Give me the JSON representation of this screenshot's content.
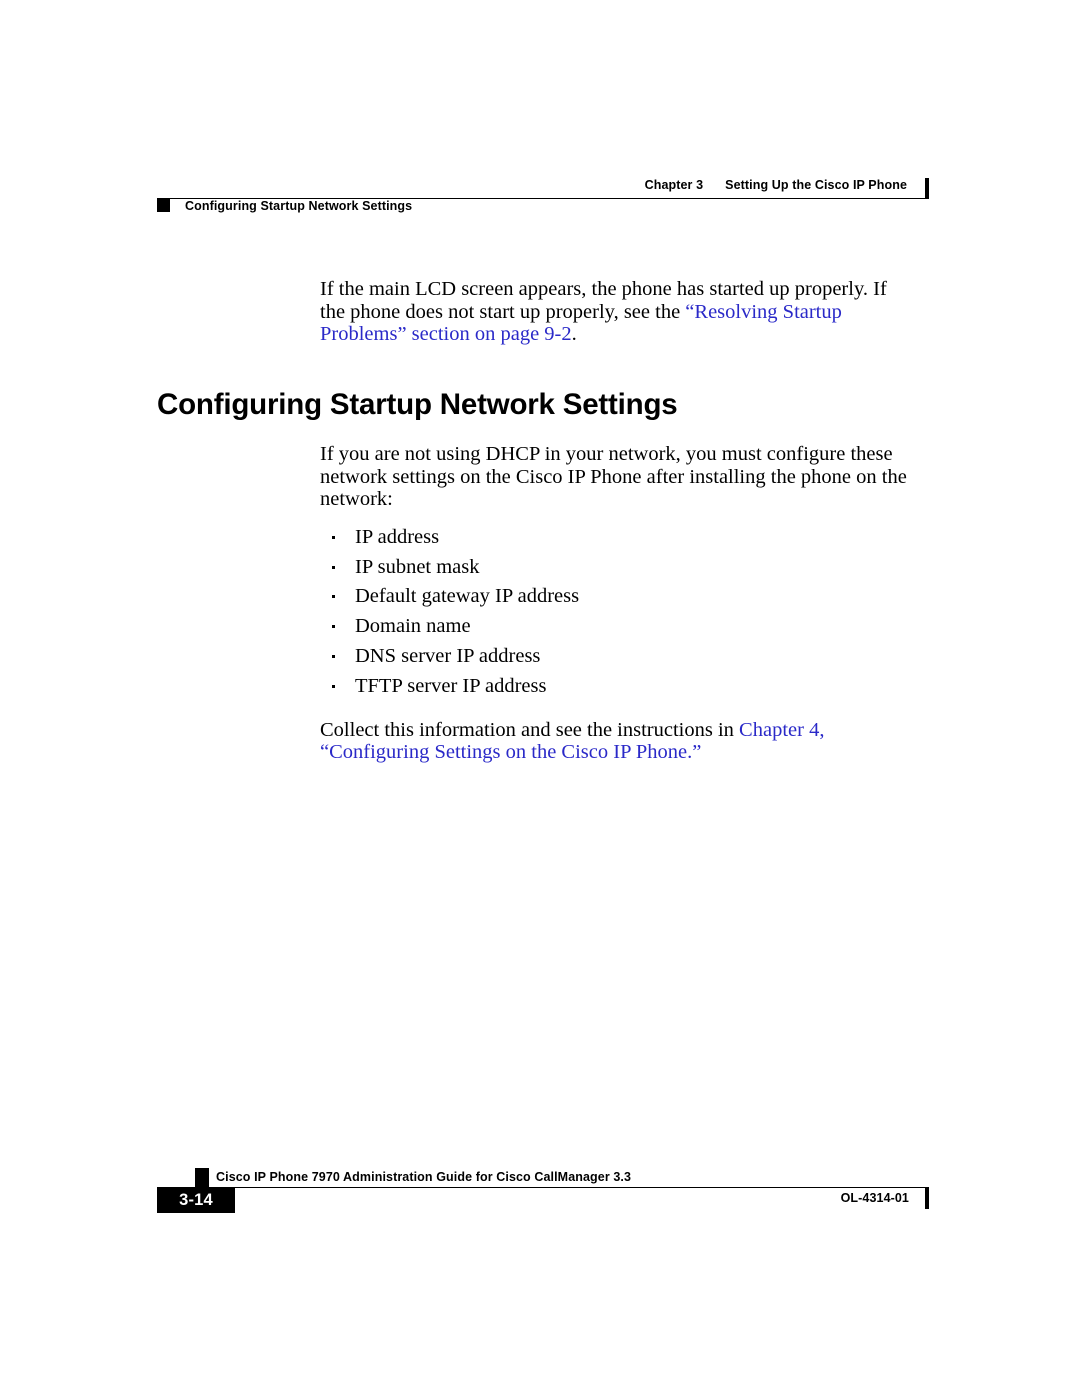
{
  "document": {
    "page_label": "3-14",
    "doc_id": "OL-4314-01",
    "footer_title": "Cisco IP Phone 7970 Administration Guide for Cisco CallManager 3.3"
  },
  "header": {
    "chapter_number": "Chapter 3",
    "chapter_title": "Setting Up the Cisco IP Phone",
    "section_title": "Configuring Startup Network Settings"
  },
  "main": {
    "intro_paragraph": {
      "before_link": "If the main LCD screen appears, the phone has started up properly. If the phone does not start up properly, see the ",
      "link_text": "“Resolving Startup Problems” section on page 9-2",
      "after_link": "."
    },
    "section_heading": "Configuring Startup Network Settings",
    "lead_paragraph": "If you are not using DHCP in your network, you must configure these network settings on the Cisco IP Phone after installing the phone on the network:",
    "bullets": [
      "IP address",
      "IP subnet mask",
      "Default gateway IP address",
      "Domain name",
      "DNS server IP address",
      "TFTP server IP address"
    ],
    "closing_paragraph": {
      "before_link": "Collect this information and see the instructions in ",
      "link_text": "Chapter 4, “Configuring Settings on the Cisco IP Phone.”",
      "after_link": ""
    }
  },
  "colors": {
    "link": "#2a29c8",
    "text": "#000000",
    "page_background": "#ffffff"
  }
}
